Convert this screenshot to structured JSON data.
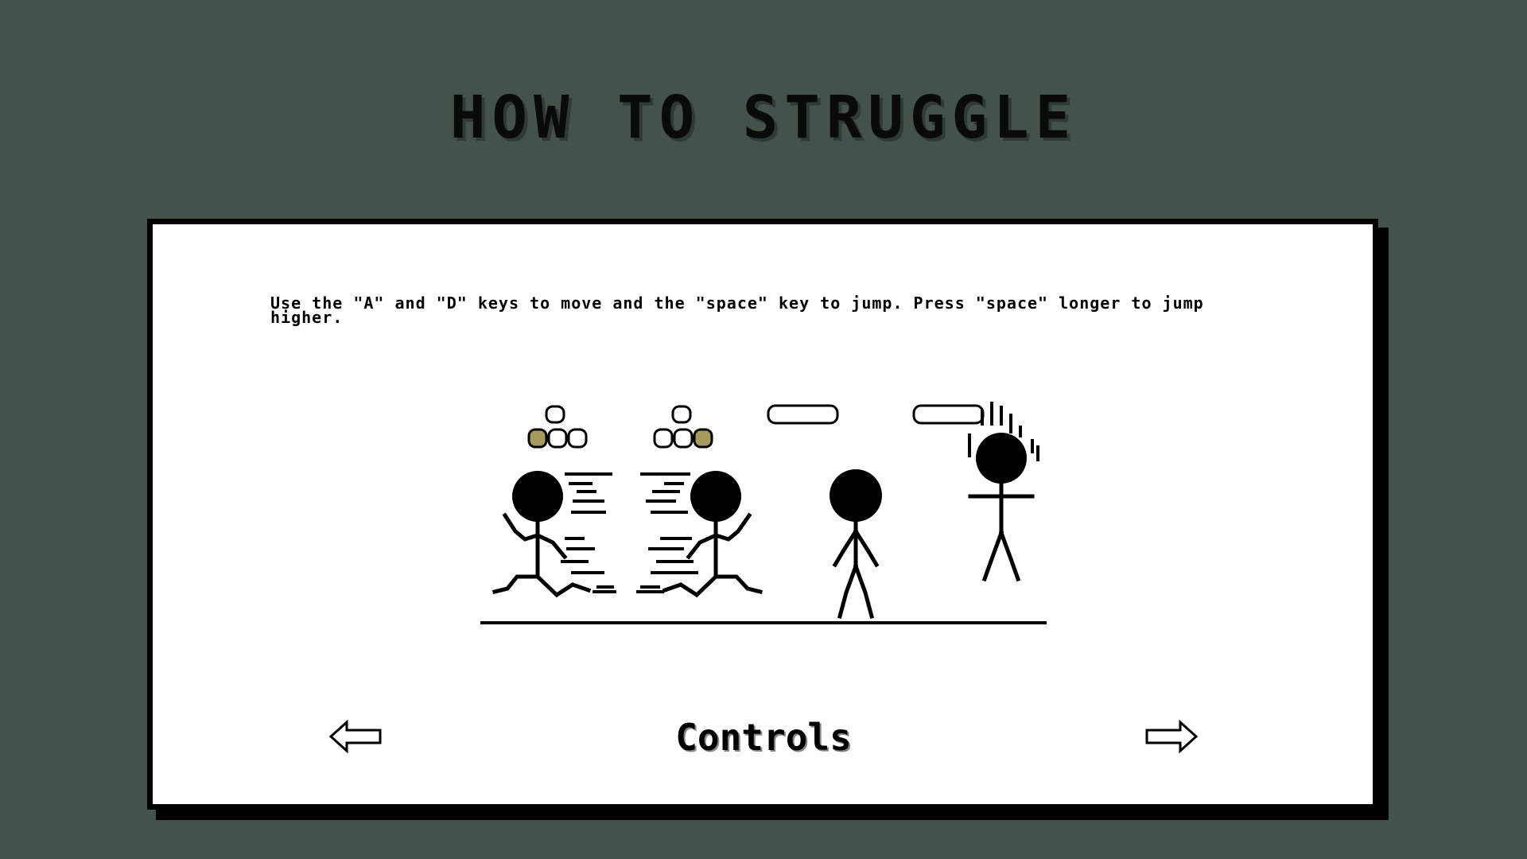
{
  "page": {
    "title": "HOW TO STRUGGLE",
    "instructions": "Use the \"A\" and \"D\" keys to move and the \"space\" key to jump. Press \"space\" longer to jump higher.",
    "caption": "Controls"
  },
  "nav": {
    "prev_icon": "left-arrow-icon",
    "next_icon": "right-arrow-icon"
  },
  "colors": {
    "background": "#43534a",
    "panel": "#ffffff",
    "ink": "#000000",
    "key_highlight": "#a89a5a"
  }
}
